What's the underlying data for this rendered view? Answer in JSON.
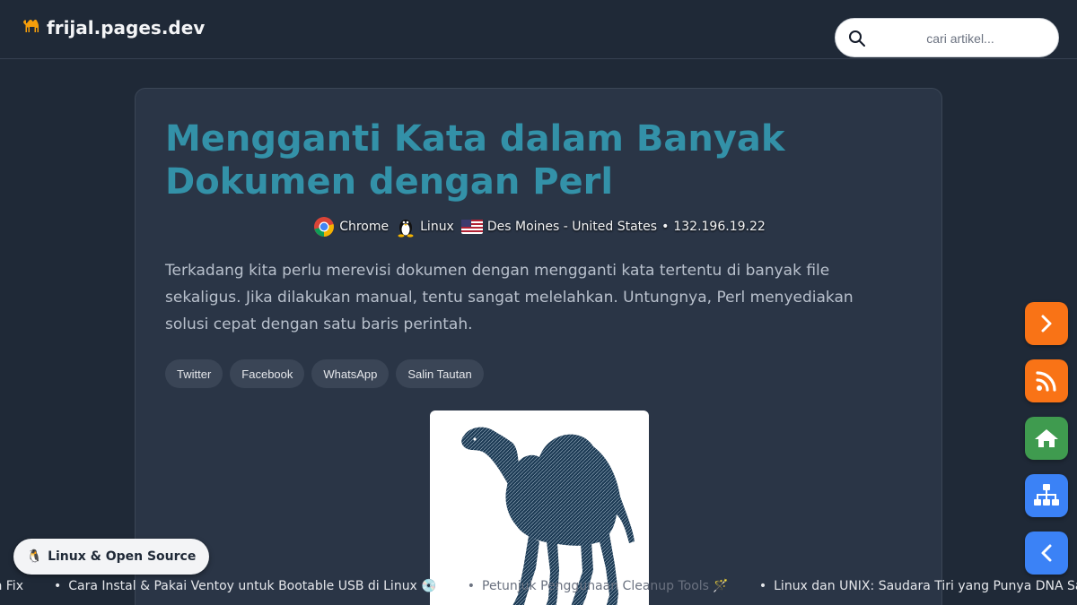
{
  "site": {
    "logo_text": "frijal.pages.dev",
    "logo_icon": "camel-icon"
  },
  "search": {
    "placeholder": "cari artikel..."
  },
  "article": {
    "title": "Mengganti Kata dalam Banyak Dokumen dengan Perl",
    "meta": {
      "browser": "Chrome",
      "os": "Linux",
      "location": "Des Moines - United States",
      "separator": "•",
      "ip": "132.196.19.22"
    },
    "intro": "Terkadang kita perlu merevisi dokumen dengan mengganti kata tertentu di banyak file sekaligus. Jika dilakukan manual, tentu sangat melelahkan. Untungnya, Perl menyediakan solusi cepat dengan satu baris perintah.",
    "share_buttons": [
      "Twitter",
      "Facebook",
      "WhatsApp",
      "Salin Tautan"
    ],
    "hero_image": "perl-camel-illustration"
  },
  "side_buttons": [
    {
      "icon": "chevron-right-icon",
      "color": "#f97316"
    },
    {
      "icon": "rss-icon",
      "color": "#f97316"
    },
    {
      "icon": "home-icon",
      "color": "#3f9b4f"
    },
    {
      "icon": "sitemap-icon",
      "color": "#3b82f6"
    },
    {
      "icon": "chevron-left-icon",
      "color": "#3b82f6"
    }
  ],
  "category": {
    "emoji": "🐧",
    "label": "Linux & Open Source"
  },
  "ticker": {
    "items": [
      "nah Fix",
      "Cara Instal & Pakai Ventoy untuk Bootable USB di Linux 💿",
      "Petunjuk Penggunaan Cleanup Tools 🪄",
      "Linux dan UNIX: Saudara Tiri yang Punya DNA Sam"
    ]
  },
  "colors": {
    "background": "#1f2937",
    "card": "#2a3546",
    "title": "#3391a8",
    "accent_orange": "#f97316",
    "accent_green": "#3f9b4f",
    "accent_blue": "#3b82f6"
  }
}
